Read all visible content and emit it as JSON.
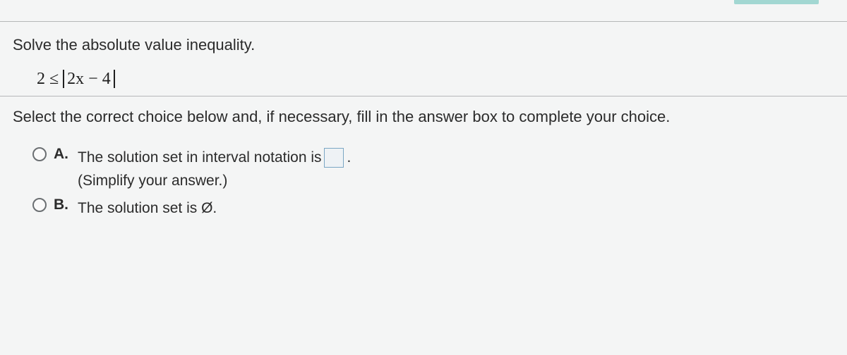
{
  "question": {
    "prompt": "Solve the absolute value inequality.",
    "expression_left": "2 ≤ ",
    "expression_abs": "2x − 4"
  },
  "instruction": "Select the correct choice below and, if necessary, fill in the answer box to complete your choice.",
  "choices": {
    "a": {
      "label": "A.",
      "text": "The solution set in interval notation is ",
      "period": ".",
      "sub": "(Simplify your answer.)"
    },
    "b": {
      "label": "B.",
      "text": "The solution set is Ø."
    }
  }
}
